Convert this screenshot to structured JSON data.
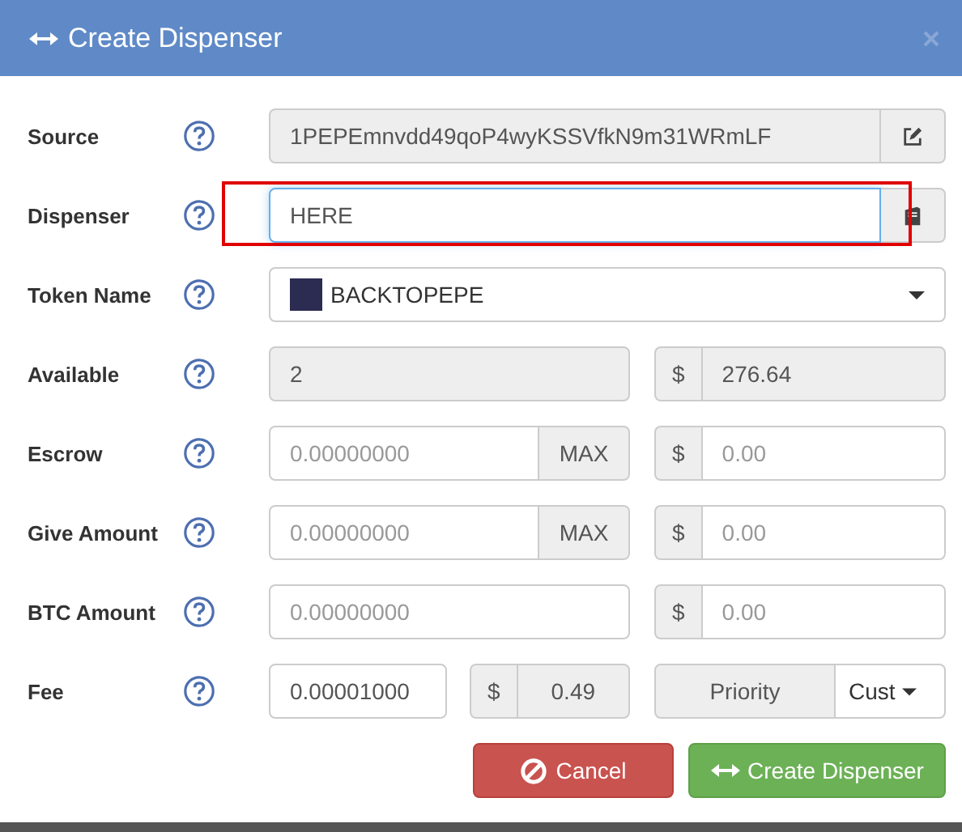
{
  "dialog": {
    "title": "Create Dispenser"
  },
  "rows": [
    {
      "kind": "address",
      "label": "Source",
      "value": "1PEPEmnvdd49qoP4wyKSSVfkN9m31WRmLF"
    },
    {
      "kind": "picker",
      "label": "Dispenser",
      "value": "HERE",
      "focused": true
    },
    {
      "kind": "select",
      "label": "Token Name",
      "value": "BACKTOPEPE"
    },
    {
      "kind": "pair",
      "label": "Available",
      "left": {
        "value": "2",
        "readonly": true
      },
      "currency": "$",
      "right": {
        "value": "276.64",
        "readonly": true
      }
    },
    {
      "kind": "pair",
      "label": "Escrow",
      "left": {
        "placeholder": "0.00000000",
        "readonly": false
      },
      "max": "MAX",
      "currency": "$",
      "right": {
        "placeholder": "0.00",
        "readonly": false
      }
    },
    {
      "kind": "pair",
      "label": "Give Amount",
      "left": {
        "placeholder": "0.00000000",
        "readonly": false
      },
      "max": "MAX",
      "currency": "$",
      "right": {
        "placeholder": "0.00",
        "readonly": false
      }
    },
    {
      "kind": "pair",
      "label": "BTC Amount",
      "left": {
        "placeholder": "0.00000000",
        "readonly": false
      },
      "currency": "$",
      "right": {
        "placeholder": "0.00",
        "readonly": false
      }
    },
    {
      "kind": "fee",
      "label": "Fee",
      "value": "0.00001000",
      "currency": "$",
      "usd": "0.49",
      "priority": "Priority",
      "custom": "Cust"
    }
  ],
  "buttons": [
    {
      "kind": "cancel",
      "label": "Cancel"
    },
    {
      "kind": "create",
      "label": "Create Dispenser"
    }
  ]
}
